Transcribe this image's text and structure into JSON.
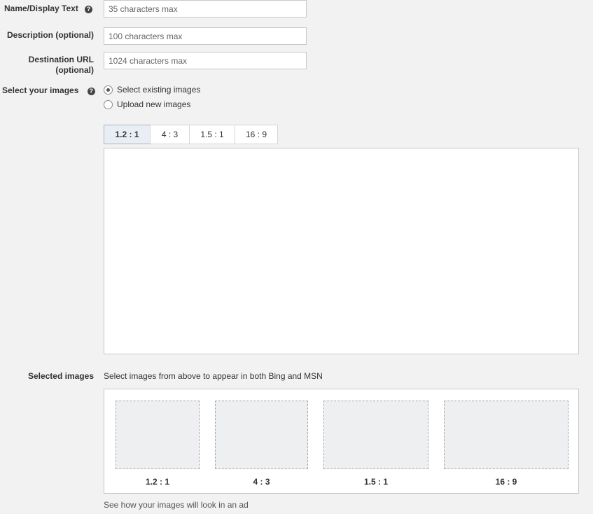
{
  "form": {
    "name_label": "Name/Display Text",
    "name_placeholder": "35 characters max",
    "description_label": "Description (optional)",
    "description_placeholder": "100 characters max",
    "url_label_line1": "Destination URL",
    "url_label_line2": "(optional)",
    "url_placeholder": "1024 characters max",
    "help_glyph": "?"
  },
  "images": {
    "label": "Select your images",
    "option_existing": "Select existing images",
    "option_upload": "Upload new images",
    "selected_option": "existing",
    "tabs": [
      "1.2 : 1",
      "4 : 3",
      "1.5 : 1",
      "16 : 9"
    ],
    "active_tab": "1.2 : 1"
  },
  "selected": {
    "label": "Selected images",
    "hint": "Select images from above to appear in both Bing and MSN",
    "slots": [
      "1.2 : 1",
      "4 : 3",
      "1.5 : 1",
      "16 : 9"
    ],
    "footer": "See how your images will look in an ad"
  }
}
